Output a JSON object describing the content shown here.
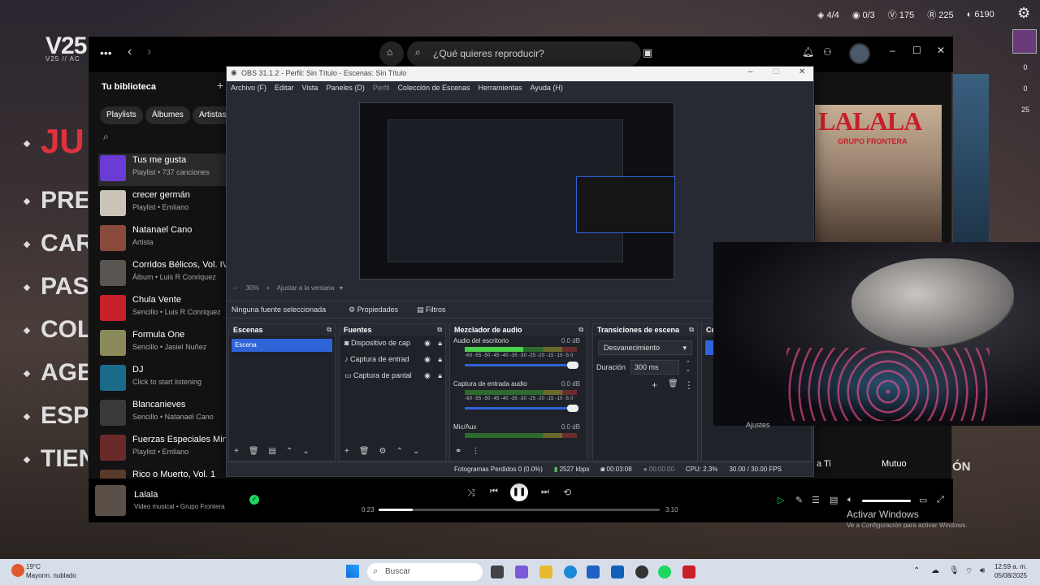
{
  "game": {
    "logo": "V25",
    "logo_sub": "V25 // AC",
    "menu": [
      "JU",
      "PRE",
      "CAR",
      "PAS",
      "COL",
      "AGE",
      "ESP",
      "TIEN"
    ],
    "stats": {
      "s1": "4/4",
      "s2": "0/3",
      "s3": "175",
      "s4": "225",
      "s5": "6190"
    },
    "right_bar": [
      "0",
      "0",
      "25"
    ],
    "bottom_text_1": "a Ti",
    "bottom_text_2": "Mutuo",
    "bottom_text_3": "ÓN",
    "webcam_label": "Ajustes"
  },
  "spotify": {
    "search_placeholder": "¿Qué quieres reproducir?",
    "library_title": "Tu biblioteca",
    "chips": [
      "Playlists",
      "Álbumes",
      "Artistas"
    ],
    "items": [
      {
        "title": "Tus me gusta",
        "sub": "Playlist • 737 canciones",
        "color": "#6b3bd6"
      },
      {
        "title": "crecer germán",
        "sub": "Playlist • Emliano",
        "color": "#c9c3b8"
      },
      {
        "title": "Natanael Cano",
        "sub": "Artista",
        "color": "#8a4a3a"
      },
      {
        "title": "Corridos Bélicos, Vol. IV",
        "sub": "Álbum • Luis R Conriquez",
        "color": "#5a5550"
      },
      {
        "title": "Chula Vente",
        "sub": "Sencillo • Luis R Conriquez",
        "color": "#c8202a"
      },
      {
        "title": "Formula One",
        "sub": "Sencillo • Jasiel Nuñez",
        "color": "#8a8a5a"
      },
      {
        "title": "DJ",
        "sub": "Click to start listening",
        "color": "#1a6a8a"
      },
      {
        "title": "Blancanieves",
        "sub": "Sencillo • Natanael Cano",
        "color": "#3a3a3a"
      },
      {
        "title": "Fuerzas Especiales Mini",
        "sub": "Playlist • Emliano",
        "color": "#6a2a2a"
      },
      {
        "title": "Rico o Muerto, Vol. 1",
        "sub": "",
        "color": "#5a3a2a"
      }
    ],
    "now_playing": {
      "title": "Lalala",
      "sub": "Video musical • Grupo Frontera",
      "elapsed": "0:23",
      "total": "3:10",
      "progress": 0.12
    },
    "album_name": "LALALA",
    "album_band": "GRUPO FRONTERA"
  },
  "obs": {
    "title": "OBS 31.1.2 - Perfil: Sin Título - Escenas: Sin Título",
    "menu": [
      "Archivo (F)",
      "Editar",
      "Vista",
      "Paneles (D)",
      "Perfil",
      "Colección de Escenas",
      "Herramientas",
      "Ayuda (H)"
    ],
    "zoom": "30%",
    "fit": "Ajustar a la ventana",
    "no_source": "Ninguna fuente seleccionada",
    "properties": "Propiedades",
    "filters": "Filtros",
    "scenes_title": "Escenas",
    "scene_selected": "Escena",
    "sources_title": "Fuentes",
    "sources": [
      "Dispositivo de cap",
      "Captura de entrad",
      "Captura de pantal"
    ],
    "mixer_title": "Mezclador de audio",
    "mixer": [
      {
        "name": "Audio del escritorio",
        "db": "0.0 dB"
      },
      {
        "name": "Captura de entrada audio",
        "db": "0.0 dB"
      },
      {
        "name": "Mic/Aux",
        "db": "0.0 dB"
      }
    ],
    "ticks": "-60 -55 -50 -45 -40 -35 -30 -25 -20 -15 -10 -5 0",
    "transitions_title": "Transiciones de escena",
    "transition": "Desvanecimiento",
    "duration_label": "Duración",
    "duration": "300 ms",
    "controls_title": "Co",
    "status": {
      "dropped": "Fotogramas Perdidos 0 (0.0%)",
      "kbps": "2527 kbps",
      "rec": "00:03:08",
      "stream": "00:00:00",
      "cpu": "CPU: 2.3%",
      "fps": "30.00 / 30.00 FPS"
    }
  },
  "windows": {
    "activate": "Activar Windows",
    "activate_sub": "Ve a Configuración para activar Windows.",
    "search": "Buscar",
    "temp": "19°C",
    "weather": "Mayorm. nublado",
    "time": "12:59 a. m.",
    "date": "05/08/2025"
  }
}
